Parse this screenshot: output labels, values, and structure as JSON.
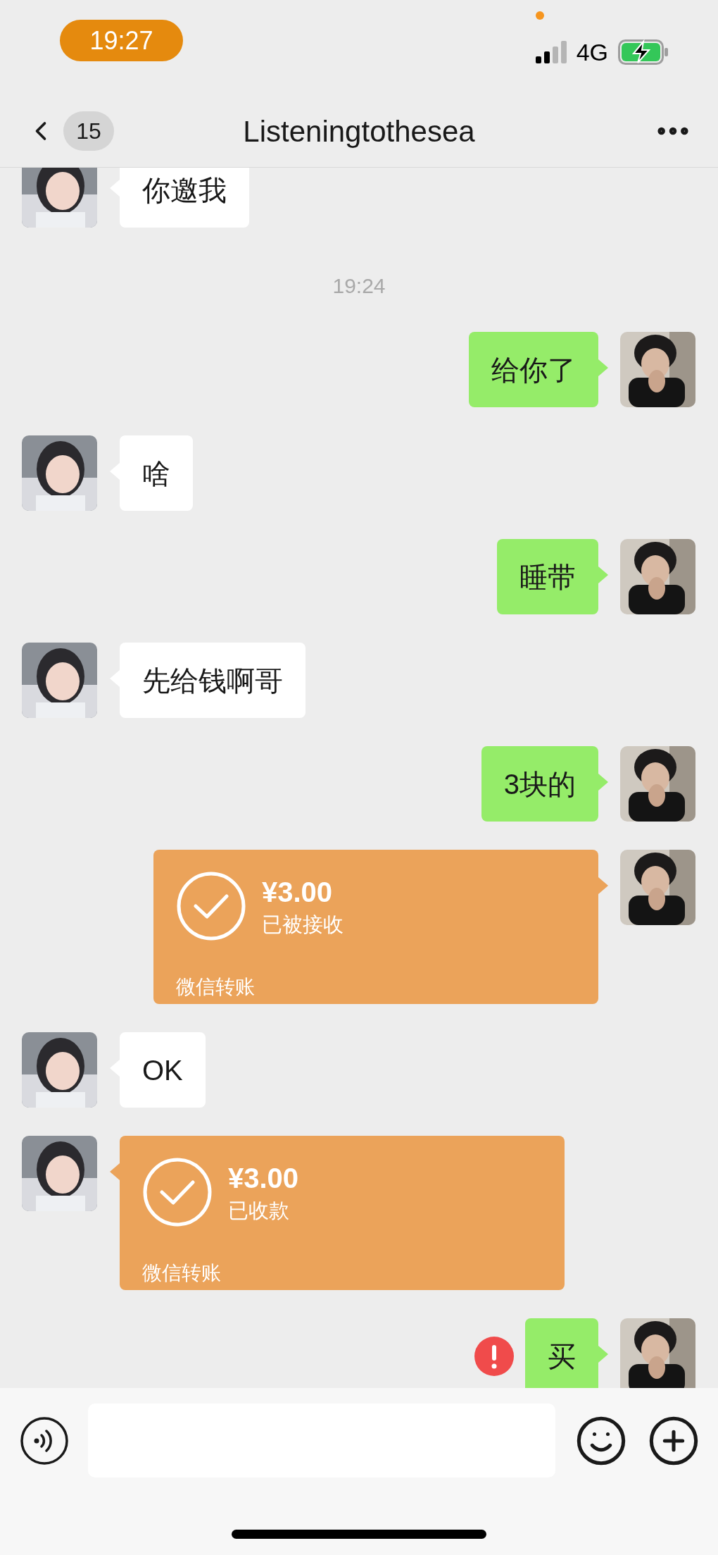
{
  "status_bar": {
    "time": "19:27",
    "network": "4G"
  },
  "header": {
    "back_badge": "15",
    "title": "Listeningtothesea"
  },
  "messages": [
    {
      "kind": "text",
      "outgoing": false,
      "text": "你邀我",
      "failed": false
    },
    {
      "kind": "time",
      "text": "19:24"
    },
    {
      "kind": "text",
      "outgoing": true,
      "text": "给你了",
      "failed": false
    },
    {
      "kind": "text",
      "outgoing": false,
      "text": "啥",
      "failed": false
    },
    {
      "kind": "text",
      "outgoing": true,
      "text": "睡带",
      "failed": false
    },
    {
      "kind": "text",
      "outgoing": false,
      "text": "先给钱啊哥",
      "failed": false
    },
    {
      "kind": "text",
      "outgoing": true,
      "text": "3块的",
      "failed": false
    },
    {
      "kind": "transfer",
      "outgoing": true,
      "amount": "¥3.00",
      "status": "已被接收",
      "label": "微信转账"
    },
    {
      "kind": "text",
      "outgoing": false,
      "text": "OK",
      "failed": false
    },
    {
      "kind": "transfer",
      "outgoing": false,
      "amount": "¥3.00",
      "status": "已收款",
      "label": "微信转账"
    },
    {
      "kind": "text",
      "outgoing": true,
      "text": "买",
      "failed": true
    }
  ]
}
